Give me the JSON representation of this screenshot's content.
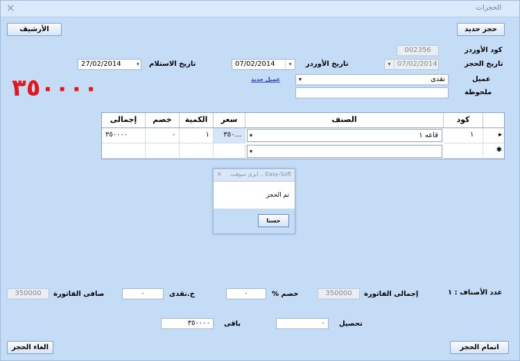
{
  "window": {
    "title": "الحجزات",
    "close_glyph": "✕"
  },
  "header_buttons": {
    "new_booking": "حجز حديد",
    "archive": "الأرشيف"
  },
  "order": {
    "code_label": "كود الأوردر",
    "code_value": "002356",
    "booking_date_label": "تاريخ الحجز",
    "booking_date_value": "07/02/2014",
    "order_date_label": "تاريخ الأوردر",
    "order_date_value": "07/02/2014",
    "receive_date_label": "تاريخ الاستلام",
    "receive_date_value": "27/02/2014",
    "client_label": "عميل",
    "client_value": "نقدى",
    "new_client_link": "عميل جديد",
    "notes_label": "ملحوظة",
    "notes_value": ""
  },
  "big_total": "٣٥٠٠٠٠",
  "grid": {
    "columns": [
      "كود",
      "الصنف",
      "سعر",
      "الكمية",
      "خصم",
      "إجمالى"
    ],
    "rows": [
      {
        "code": "١",
        "item": "قاعه ١",
        "price": "٣٥٠...",
        "qty": "١",
        "discount": "٠",
        "total": "٣٥٠٠٠٠"
      }
    ],
    "current_row_marker": "▸",
    "new_row_marker": "✱"
  },
  "dialog": {
    "title": "ايزى سوفت .. Easy-Soft",
    "message": "تم الحجز",
    "ok": "حسنا",
    "close_glyph": "✕"
  },
  "summary": {
    "items_count_label": "عدد الأصناف : ١",
    "invoice_total_label": "إجمالى الفاتورة",
    "invoice_total_value": "350000",
    "discount_pct_label": "خصم %",
    "discount_pct_value": "٠",
    "cash_discount_label": "خ.نقدى",
    "cash_discount_value": "٠",
    "net_label": "صافى الفاتورة",
    "net_value": "350000",
    "collect_label": "تحصيل",
    "collect_value": "٠",
    "remaining_label": "باقى",
    "remaining_value": "٣٥٠٠٠٠"
  },
  "footer_buttons": {
    "complete": "اتمام الحجز",
    "cancel": "الغاء الحجز"
  }
}
